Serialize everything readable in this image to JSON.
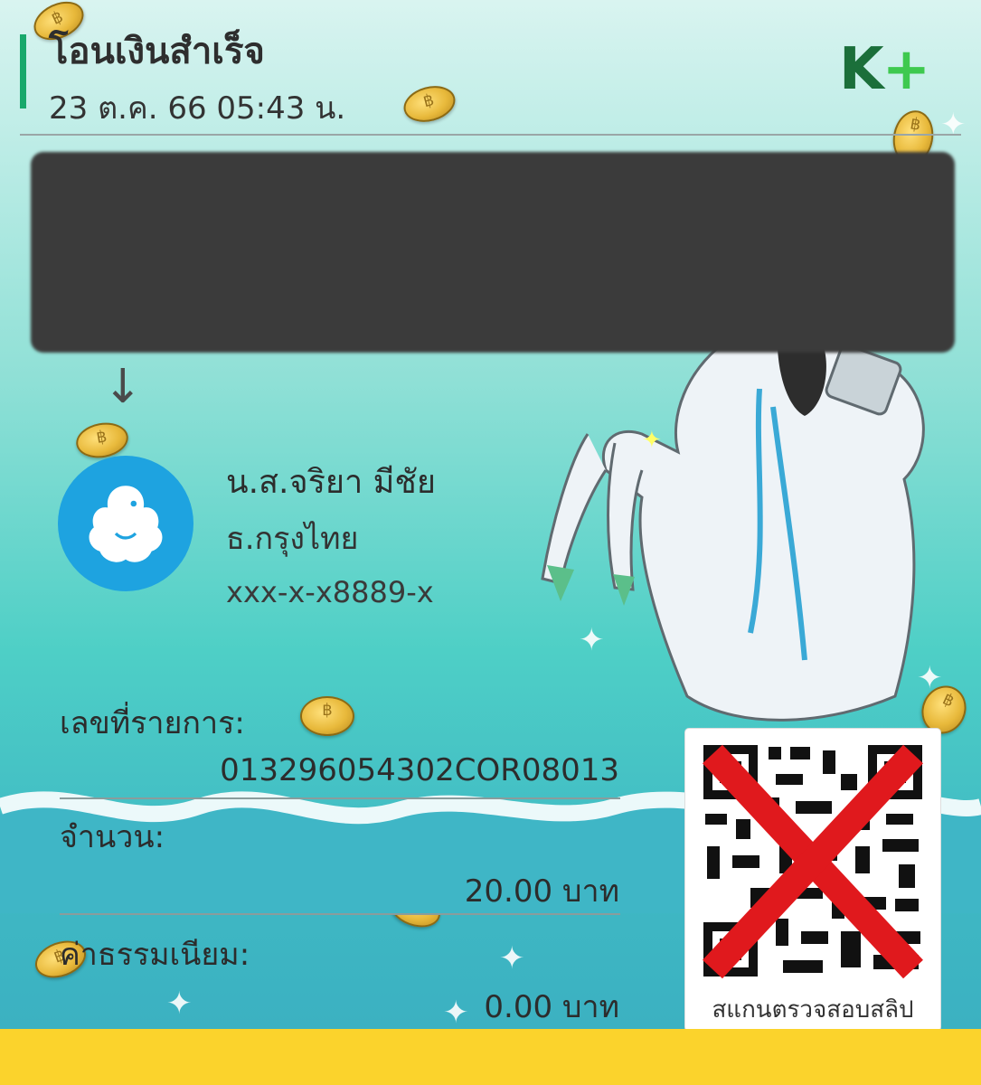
{
  "header": {
    "title": "โอนเงินสำเร็จ",
    "datetime": "23 ต.ค. 66  05:43 น.",
    "brand_k": "K",
    "brand_plus": "+"
  },
  "recipient": {
    "name": "น.ส.จริยา มีชัย",
    "bank": "ธ.กรุงไทย",
    "account": "xxx-x-x8889-x"
  },
  "details": {
    "ref_label": "เลขที่รายการ:",
    "ref_value": "013296054302COR08013",
    "amount_label": "จำนวน:",
    "amount_value": "20.00 บาท",
    "fee_label": "ค่าธรรมเนียม:",
    "fee_value": "0.00 บาท"
  },
  "qr": {
    "caption": "สแกนตรวจสอบสลิป"
  },
  "colors": {
    "accent_green": "#18a86b",
    "krungthai_blue": "#1ea3e0",
    "bottom_yellow": "#fbd32c",
    "cross_red": "#e0191d"
  }
}
